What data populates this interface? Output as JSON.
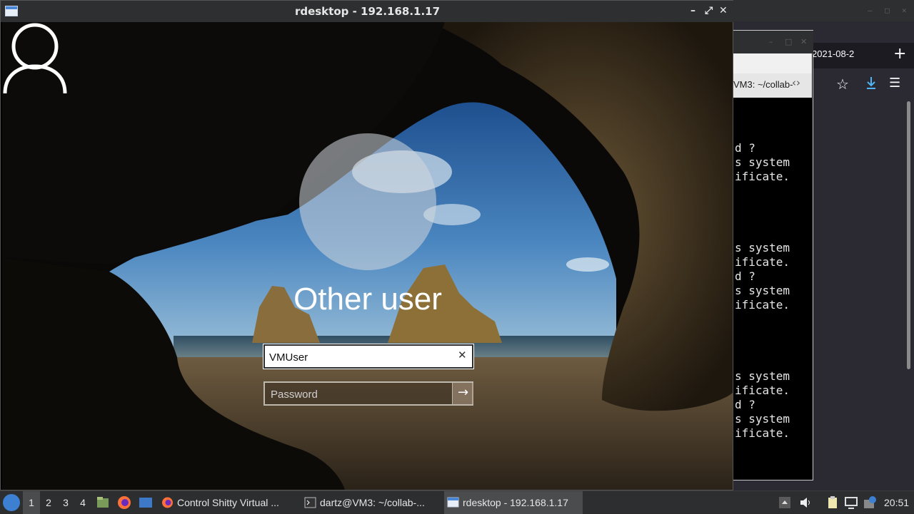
{
  "rdesktop_window": {
    "title": "rdesktop - 192.168.1.17",
    "minimize": "–",
    "maximize": "⤢",
    "close": "✕"
  },
  "lockscreen": {
    "user_name": "Other user",
    "username_value": "VMUser",
    "password_placeholder": "Password",
    "clear_glyph": "✕",
    "submit_glyph": "→"
  },
  "background_browser": {
    "tab_label": "2021-08-2",
    "new_tab": "+",
    "window_controls": [
      "–",
      "□",
      "✕"
    ]
  },
  "terminal": {
    "tab_label": "VM3: ~/collab-",
    "window_controls": [
      "–",
      "□",
      "✕"
    ],
    "lines": [
      "d ?",
      "s system",
      "ificate.",
      "",
      "",
      "",
      "",
      "s system",
      "ificate.",
      "d ?",
      "s system",
      "ificate.",
      "",
      "",
      "",
      "",
      "s system",
      "ificate.",
      "d ?",
      "s system",
      "ificate."
    ]
  },
  "taskbar": {
    "workspaces": [
      "1",
      "2",
      "3",
      "4"
    ],
    "active_workspace": "1",
    "tasks": [
      {
        "label": "Control Shitty Virtual ...",
        "icon": "firefox-icon"
      },
      {
        "label": "dartz@VM3: ~/collab-...",
        "icon": "terminal-icon"
      },
      {
        "label": "rdesktop - 192.168.1.17",
        "icon": "window-icon",
        "active": true
      }
    ],
    "clock": "20:51"
  }
}
